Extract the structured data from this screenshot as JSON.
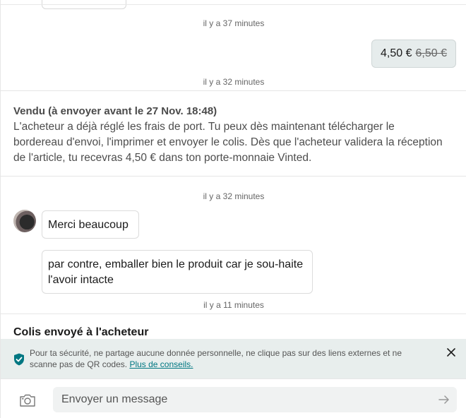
{
  "conversation": {
    "timestamp_1": "il y a 37 minutes",
    "price_offer": {
      "new_price": "4,50 €",
      "old_price": "6,50 €"
    },
    "timestamp_2": "il y a 32 minutes",
    "sold_status": {
      "title": "Vendu (à envoyer avant le 27 Nov. 18:48)",
      "text": "L'acheteur a déjà réglé les frais de port. Tu peux dès maintenant télécharger le bordereau d'envoi, l'imprimer et envoyer le colis. Dès que l'acheteur validera la réception de l'article, tu recevras 4,50 € dans ton porte-monnaie Vinted."
    },
    "timestamp_3": "il y a 32 minutes",
    "message_1": "Merci beaucoup",
    "message_2": "par contre, emballer bien le produit car je sou-haite l'avoir intacte",
    "timestamp_4": "il y a 11 minutes",
    "shipped_title": "Colis envoyé à l'acheteur"
  },
  "safety_banner": {
    "text": "Pour ta sécurité, ne partage aucune donnée personnelle, ne clique pas sur des liens externes et ne scanne pas de QR codes.",
    "link": "Plus de conseils."
  },
  "composer": {
    "placeholder": "Envoyer un message"
  },
  "colors": {
    "accent": "#007782",
    "banner_bg": "#e8eeed",
    "price_bubble_bg": "#e6ecec"
  }
}
